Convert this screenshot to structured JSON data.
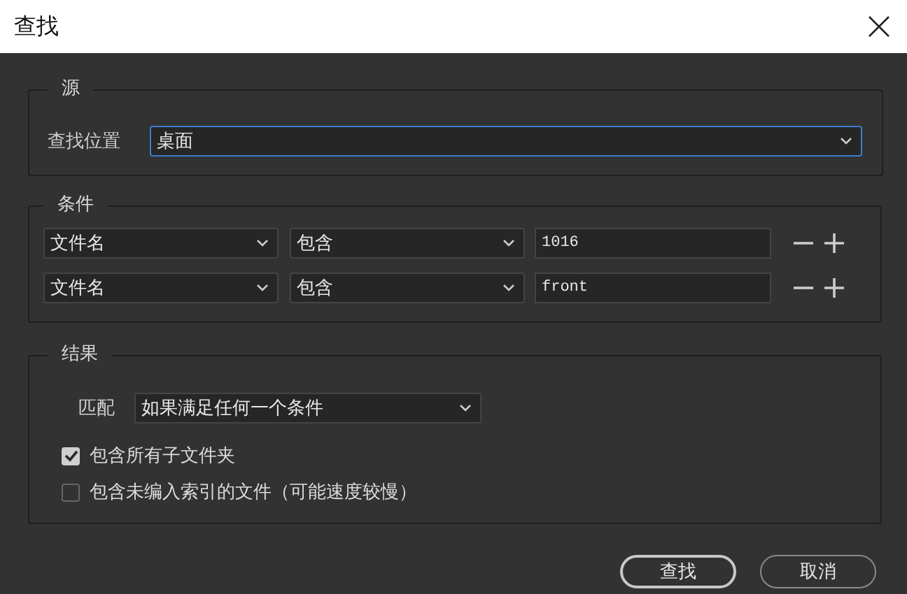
{
  "window": {
    "title": "查找"
  },
  "source": {
    "legend": "源",
    "label": "查找位置",
    "location": {
      "value": "桌面",
      "focused": true
    }
  },
  "conditions": {
    "legend": "条件",
    "rows": [
      {
        "field": "文件名",
        "operator": "包含",
        "value": "1016"
      },
      {
        "field": "文件名",
        "operator": "包含",
        "value": "front"
      }
    ]
  },
  "results": {
    "legend": "结果",
    "match_label": "匹配",
    "match": "如果满足任何一个条件",
    "options": [
      {
        "label": "包含所有子文件夹",
        "checked": true
      },
      {
        "label": "包含未编入索引的文件（可能速度较慢）",
        "checked": false
      }
    ]
  },
  "buttons": [
    {
      "label": "查找",
      "default": true
    },
    {
      "label": "取消",
      "default": false
    }
  ]
}
